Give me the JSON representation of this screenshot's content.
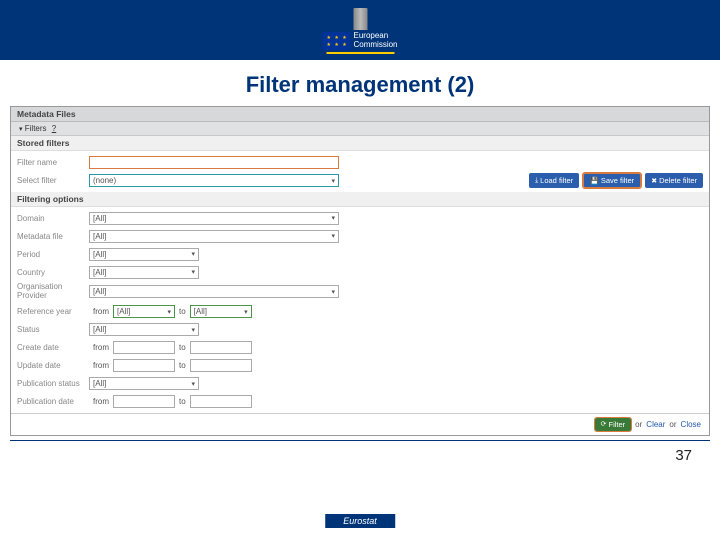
{
  "header": {
    "org_line1": "European",
    "org_line2": "Commission"
  },
  "slide": {
    "title": "Filter management (2)",
    "page_number": "37",
    "footer": "Eurostat"
  },
  "panel": {
    "title": "Metadata Files",
    "filters_label": "Filters",
    "help_icon": "?"
  },
  "stored": {
    "header": "Stored filters",
    "filter_name_label": "Filter name",
    "filter_name_value": "",
    "select_filter_label": "Select filter",
    "select_filter_value": "(none)",
    "load_btn": "Load filter",
    "save_btn": "Save filter",
    "delete_btn": "Delete filter"
  },
  "options": {
    "header": "Filtering options",
    "domain_label": "Domain",
    "domain_value": "[All]",
    "metadata_file_label": "Metadata file",
    "metadata_file_value": "[All]",
    "period_label": "Period",
    "period_value": "[All]",
    "country_label": "Country",
    "country_value": "[All]",
    "org_label": "Organisation Provider",
    "org_value": "[All]",
    "ref_year_label": "Reference year",
    "ref_year_from": "[All]",
    "ref_year_to": "[All]",
    "status_label": "Status",
    "status_value": "[All]",
    "create_date_label": "Create date",
    "update_date_label": "Update date",
    "pub_status_label": "Publication status",
    "pub_status_value": "[All]",
    "pub_date_label": "Publication date",
    "from_text": "from",
    "to_text": "to"
  },
  "actions": {
    "filter_btn": "Filter",
    "or_text": "or",
    "clear_link": "Clear",
    "close_link": "Close"
  }
}
